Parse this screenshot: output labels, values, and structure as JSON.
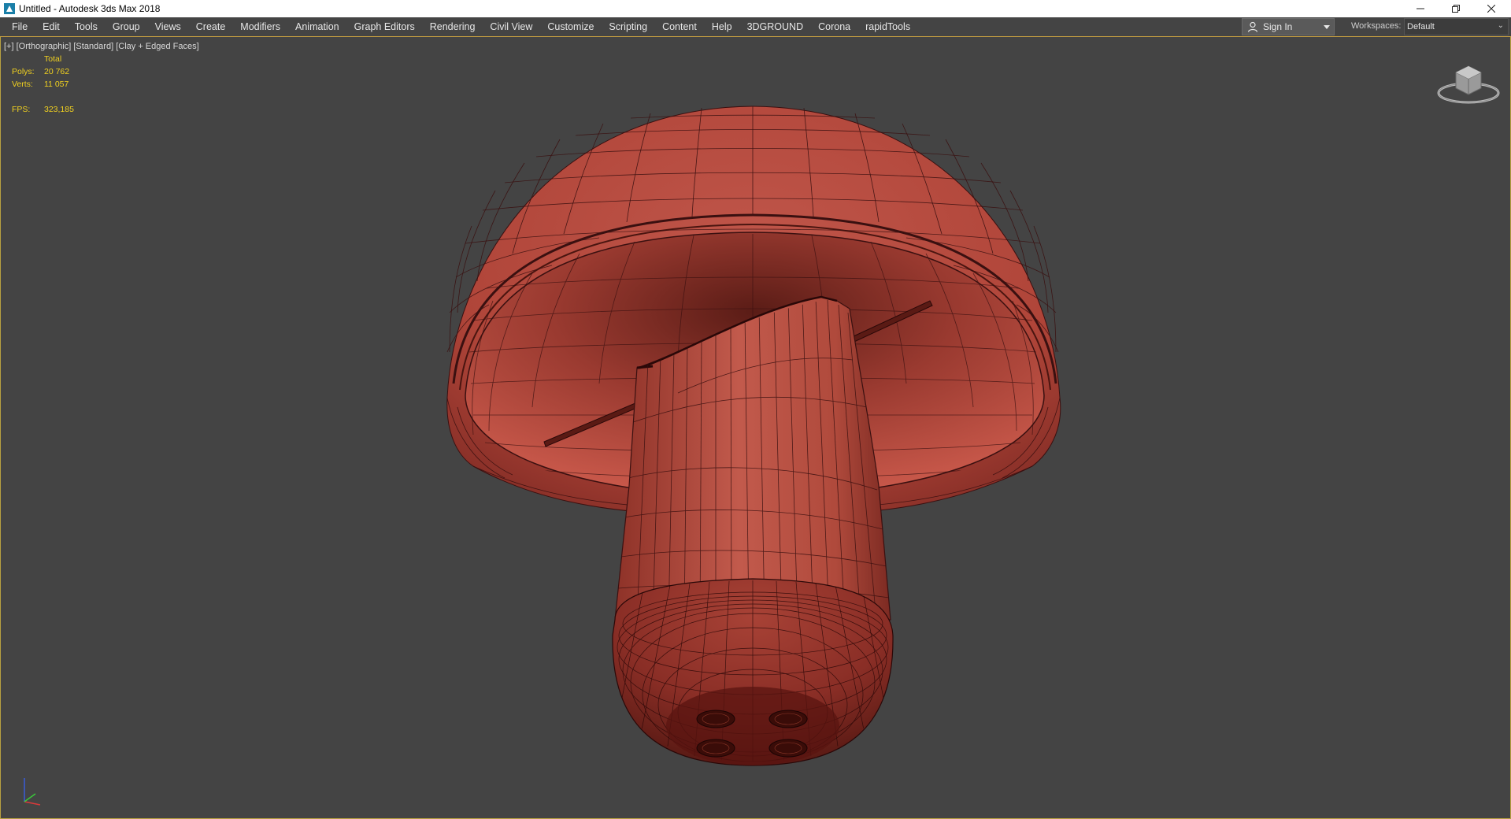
{
  "window": {
    "title": "Untitled - Autodesk 3ds Max 2018",
    "icons": [
      "max-app-icon",
      "minimize-icon",
      "restore-icon",
      "close-icon"
    ]
  },
  "menubar": {
    "items": [
      "File",
      "Edit",
      "Tools",
      "Group",
      "Views",
      "Create",
      "Modifiers",
      "Animation",
      "Graph Editors",
      "Rendering",
      "Civil View",
      "Customize",
      "Scripting",
      "Content",
      "Help",
      "3DGROUND",
      "Corona",
      "rapidTools"
    ],
    "sign_in": "Sign In",
    "workspaces_label": "Workspaces:",
    "workspace_value": "Default"
  },
  "viewport": {
    "label": {
      "plus": "[+]",
      "view": "[Orthographic]",
      "shading_preset": "[Standard]",
      "shading_mode": "[Clay + Edged Faces]"
    },
    "stats": {
      "header": "Total",
      "polys_label": "Polys:",
      "polys_value": "20 762",
      "verts_label": "Verts:",
      "verts_value": "11 057",
      "fps_label": "FPS:",
      "fps_value": "323,185"
    },
    "colors": {
      "background": "#444444",
      "stats_text": "#f0d020",
      "model_clay": "#b8463a",
      "model_edges": "#3a1010",
      "active_border": "#b8a040"
    }
  }
}
